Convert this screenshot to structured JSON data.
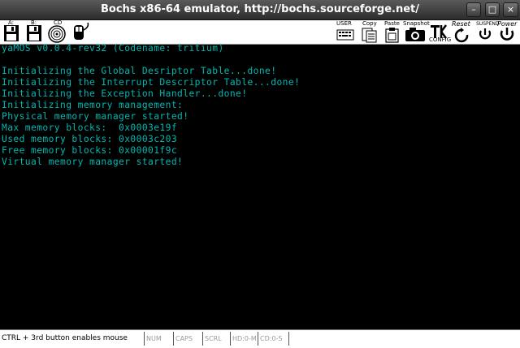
{
  "window": {
    "title": "Bochs x86-64 emulator, http://bochs.sourceforge.net/",
    "minimize_glyph": "–",
    "maximize_glyph": "□",
    "close_glyph": "×"
  },
  "toolbar": {
    "floppy_a_label": "A:",
    "floppy_b_label": "B:",
    "cdrom_label": "CD",
    "user_label": "USER",
    "copy_label": "Copy",
    "paste_label": "Paste",
    "snapshot_label": "Snapshot",
    "config_label": "CONFIG",
    "reset_label": "Reset",
    "suspend_label": "SUSPEND",
    "power_label": "Power"
  },
  "console": {
    "lines": [
      "yaMOS v0.0.4-rev32 (Codename: tritium)",
      "",
      "Initializing the Global Desriptor Table...done!",
      "Initializing the Interrupt Descriptor Table...done!",
      "Initializing the Exception Handler...done!",
      "Initializing memory management:",
      "Physical memory manager started!",
      "Max memory blocks:  0x0003e19f",
      "Used memory blocks: 0x0003c203",
      "Free memory blocks: 0x00001f9c",
      "Virtual memory manager started!"
    ]
  },
  "status": {
    "message": "CTRL + 3rd button enables mouse",
    "num": "NUM",
    "caps": "CAPS",
    "scrl": "SCRL",
    "hd": "HD:0-M",
    "cd": "CD:0-S"
  }
}
